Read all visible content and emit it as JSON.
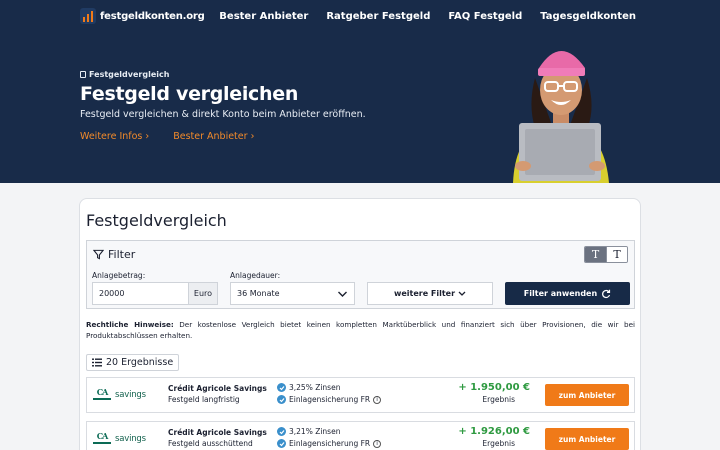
{
  "header": {
    "logo_text": "festgeldkonten.org",
    "nav": [
      "Bester Anbieter",
      "Ratgeber Festgeld",
      "FAQ Festgeld",
      "Tagesgeldkonten"
    ]
  },
  "hero": {
    "breadcrumb": "Festgeldvergleich",
    "title": "Festgeld vergleichen",
    "subtitle": "Festgeld vergleichen & direkt Konto beim Anbieter eröffnen.",
    "links": [
      "Weitere Infos",
      "Bester Anbieter"
    ]
  },
  "comparison": {
    "title": "Festgeldvergleich",
    "filter": {
      "label": "Filter",
      "toggle": [
        "T",
        "T"
      ],
      "amount_label": "Anlagebetrag:",
      "amount_value": "20000",
      "amount_unit": "Euro",
      "duration_label": "Anlagedauer:",
      "duration_value": "36 Monate",
      "more_filters": "weitere Filter",
      "apply": "Filter anwenden"
    },
    "legal_title": "Rechtliche Hinweise:",
    "legal_text": "Der kostenlose Vergleich bietet keinen kompletten Marktüberblick und finanziert sich über Provisionen, die wir bei Produktabschlüssen erhalten.",
    "results_count": "20 Ergebnisse",
    "offers": [
      {
        "logo_initials": "CA",
        "logo_text": "savings",
        "bank": "Crédit Agricole Savings",
        "product": "Festgeld langfristig",
        "rate": "3,25% Zinsen",
        "protection": "Einlagensicherung FR",
        "result": "+ 1.950,00 €",
        "result_label": "Ergebnis",
        "cta": "zum Anbieter"
      },
      {
        "logo_initials": "CA",
        "logo_text": "savings",
        "bank": "Crédit Agricole Savings",
        "product": "Festgeld ausschüttend",
        "rate": "3,21% Zinsen",
        "protection": "Einlagensicherung FR",
        "result": "+ 1.926,00 €",
        "result_label": "Ergebnis",
        "cta": "zum Anbieter"
      }
    ]
  },
  "colors": {
    "navy": "#182b49",
    "accent_orange": "#f07a18",
    "result_green": "#2f9a41",
    "check_blue": "#3a8fcb"
  }
}
